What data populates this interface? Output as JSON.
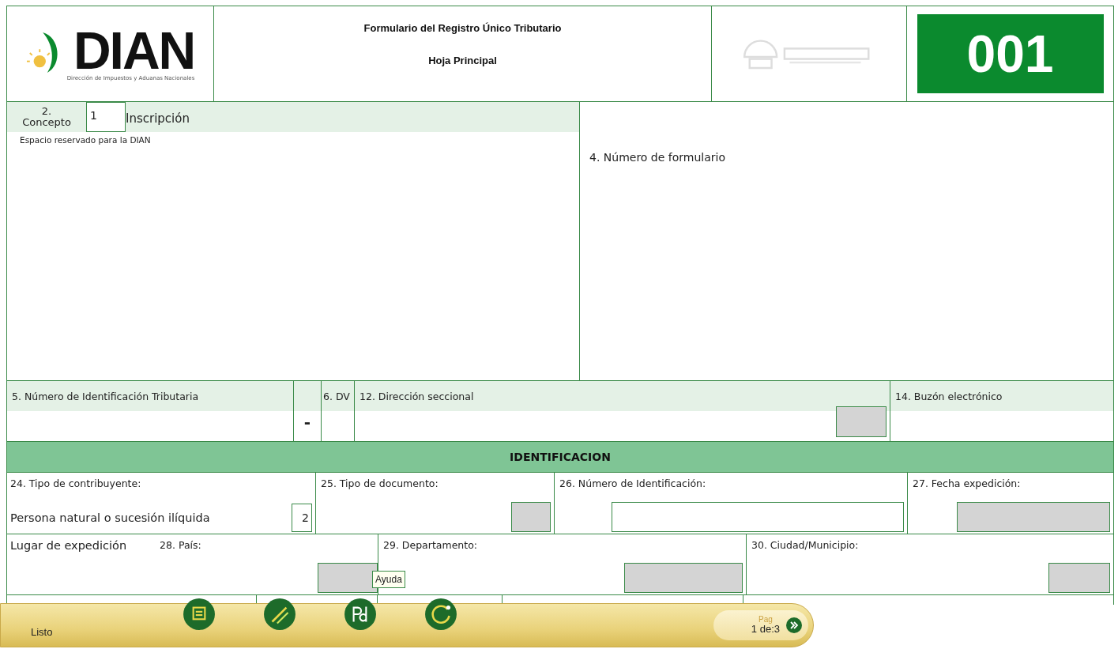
{
  "header": {
    "logo_text": "DIAN",
    "logo_subtitle": "Dirección de Impuestos y Aduanas Nacionales",
    "title": "Formulario del Registro Único Tributario",
    "subtitle": "Hoja Principal",
    "form_number": "001"
  },
  "concept": {
    "label_number": "2.",
    "label": "Concepto",
    "value": "1",
    "value_text": "Inscripción",
    "reserved": "Espacio reservado para la DIAN",
    "form_number_label": "4. Número de formulario"
  },
  "row_nit": {
    "nit_label": "5. Número de Identificación Tributaria",
    "separator": "-",
    "dv_label": "6. DV",
    "seccional_label": "12. Dirección seccional",
    "buzon_label": "14. Buzón electrónico"
  },
  "section_title": "IDENTIFICACION",
  "row_id": {
    "tipo_contribuyente_label": "24. Tipo de contribuyente:",
    "tipo_contribuyente_value": "Persona natural o sucesión ilíquida",
    "tipo_contribuyente_code": "2",
    "tipo_documento_label": "25. Tipo de documento:",
    "numero_label": "26. Número de Identificación:",
    "fecha_label": "27. Fecha expedición:"
  },
  "row_lugar": {
    "title": "Lugar de expedición",
    "pais_label": "28.  País:",
    "departamento_label": "29. Departamento:",
    "ciudad_label": "30. Ciudad/Municipio:"
  },
  "tooltip": "Ayuda",
  "status_bar": {
    "status": "Listo",
    "page_label": "Pag",
    "page": "1 de:3"
  }
}
